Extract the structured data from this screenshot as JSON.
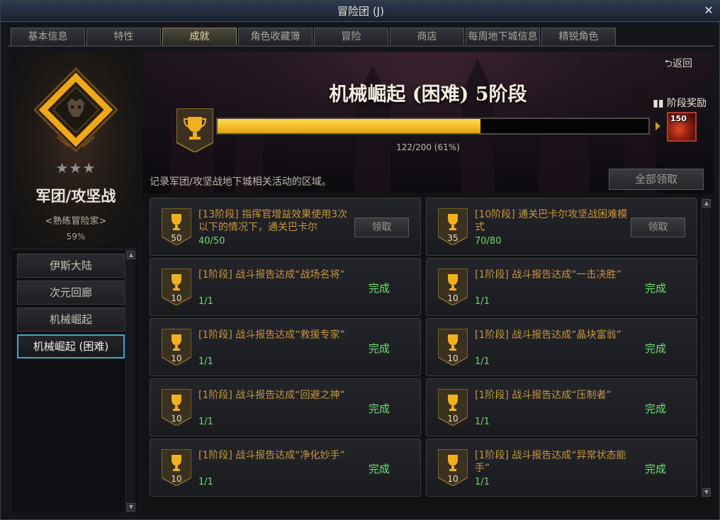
{
  "window": {
    "title": "冒险团 (J)"
  },
  "tabs": [
    {
      "label": "基本信息",
      "active": false
    },
    {
      "label": "特性",
      "active": false
    },
    {
      "label": "成就",
      "active": true
    },
    {
      "label": "角色收藏簿",
      "active": false
    },
    {
      "label": "冒险",
      "active": false
    },
    {
      "label": "商店",
      "active": false
    },
    {
      "label": "每周地下城信息",
      "active": false
    },
    {
      "label": "精锐角色",
      "active": false
    }
  ],
  "rank": {
    "stars": "★★★",
    "title": "军团/攻坚战",
    "subtitle": "<熟练冒险家>",
    "percent": "59%"
  },
  "areas": [
    {
      "label": "伊斯大陆",
      "selected": false
    },
    {
      "label": "次元回廊",
      "selected": false
    },
    {
      "label": "机械崛起",
      "selected": false
    },
    {
      "label": "机械崛起 (困难)",
      "selected": true
    }
  ],
  "stage": {
    "return_label": "返回",
    "title": "机械崛起 (困难) 5阶段",
    "reward_label": "阶段奖励",
    "reward_count": "150",
    "progress_current": 122,
    "progress_total": 200,
    "progress_text": "122/200 (61%)",
    "description": "记录军团/攻坚战地下城相关活动的区域。",
    "claim_all_label": "全部领取"
  },
  "achievements": [
    {
      "points": "50",
      "text": "[13阶段] 指挥官增益效果使用3次以下的情况下，通关巴卡尔",
      "progress": "40/50",
      "status": "claim",
      "action": "领取"
    },
    {
      "points": "35",
      "text": "[10阶段] 通关巴卡尔攻坚战困难模式",
      "progress": "70/80",
      "status": "claim",
      "action": "领取"
    },
    {
      "points": "10",
      "text": "[1阶段] 战斗报告达成“战场名将”",
      "progress": "1/1",
      "status": "done",
      "action": "完成"
    },
    {
      "points": "10",
      "text": "[1阶段] 战斗报告达成“一击决胜”",
      "progress": "1/1",
      "status": "done",
      "action": "完成"
    },
    {
      "points": "10",
      "text": "[1阶段] 战斗报告达成“救援专家”",
      "progress": "1/1",
      "status": "done",
      "action": "完成"
    },
    {
      "points": "10",
      "text": "[1阶段] 战斗报告达成“晶块富翁”",
      "progress": "1/1",
      "status": "done",
      "action": "完成"
    },
    {
      "points": "10",
      "text": "[1阶段] 战斗报告达成“回避之神”",
      "progress": "1/1",
      "status": "done",
      "action": "完成"
    },
    {
      "points": "10",
      "text": "[1阶段] 战斗报告达成“压制者”",
      "progress": "1/1",
      "status": "done",
      "action": "完成"
    },
    {
      "points": "10",
      "text": "[1阶段] 战斗报告达成“净化妙手”",
      "progress": "1/1",
      "status": "done",
      "action": "完成"
    },
    {
      "points": "10",
      "text": "[1阶段] 战斗报告达成“异常状态能手”",
      "progress": "1/1",
      "status": "done",
      "action": "完成"
    }
  ],
  "colors": {
    "gold": "#e8a010",
    "done_green": "#6fe06f",
    "selected_border": "#3fa6d6",
    "achievement_text": "#c8963c"
  }
}
